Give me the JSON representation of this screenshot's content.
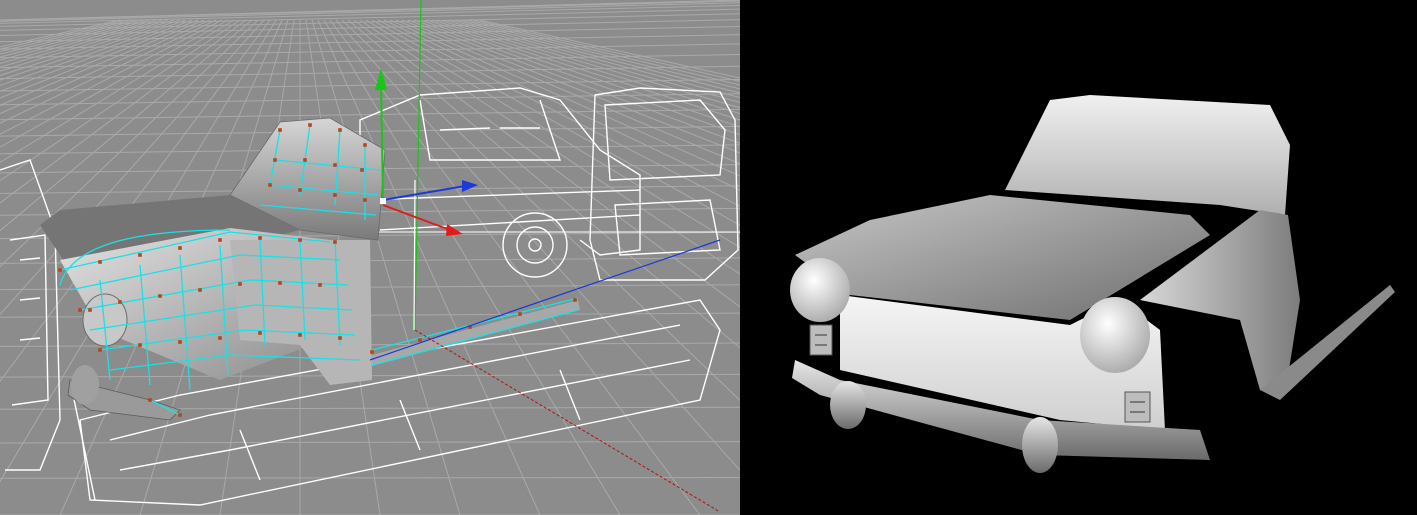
{
  "app": {
    "layout": "split-view",
    "left_panel": "editor-viewport",
    "right_panel": "render-viewport"
  },
  "editor": {
    "background_color": "#8c8c8c",
    "grid_color": "#a9a9a9",
    "reference_line_color": "#ffffff",
    "mesh_wire_color": "#19e1e6",
    "control_point_color": "#b4461e",
    "axis": {
      "x_color": "#e01b1b",
      "y_color": "#18c618",
      "z_color": "#1b3ad8"
    },
    "icons": [
      "move-gizmo-icon",
      "vertical-guide-line",
      "horizontal-guide-line"
    ]
  },
  "render": {
    "background_color": "#000000",
    "surface_color": "#d4d4d4"
  }
}
